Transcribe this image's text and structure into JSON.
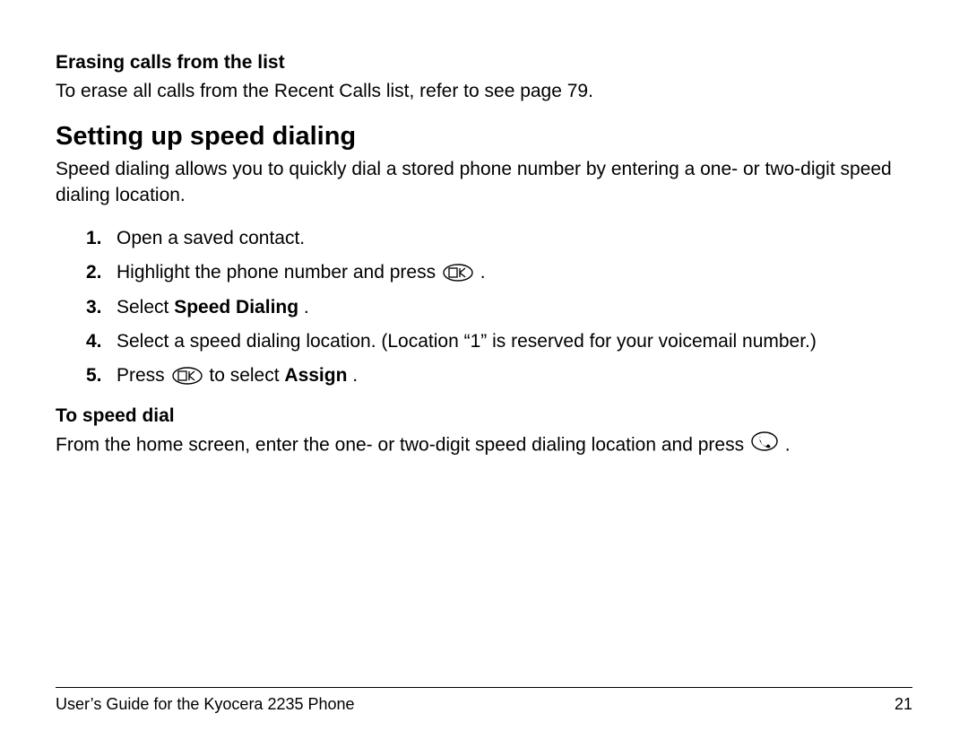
{
  "sections": {
    "erasing": {
      "heading": "Erasing calls from the list",
      "body": "To erase all calls from the Recent Calls list, refer to see page 79."
    },
    "speed_dialing": {
      "heading": "Setting up speed dialing",
      "intro": "Speed dialing allows you to quickly dial a stored phone number by entering a one- or two-digit speed dialing location.",
      "steps": {
        "s1": "Open a saved contact.",
        "s2_pre": "Highlight the phone number and press ",
        "s2_post": " .",
        "s3_pre": "Select ",
        "s3_bold": "Speed Dialing",
        "s3_post": ".",
        "s4": "Select a speed dialing location. (Location “1” is reserved for your voicemail number.)",
        "s5_pre": "Press ",
        "s5_mid": " to select ",
        "s5_bold": "Assign",
        "s5_post": "."
      }
    },
    "to_speed_dial": {
      "heading": "To speed dial",
      "body_pre": "From the home screen, enter the one- or two-digit speed dialing location and press ",
      "body_post": " ."
    }
  },
  "icons": {
    "ok_label": "OK",
    "phone_label": "call"
  },
  "footer": {
    "left": "User’s Guide for the Kyocera 2235 Phone",
    "right": "21"
  },
  "nums": {
    "n1": "1.",
    "n2": "2.",
    "n3": "3.",
    "n4": "4.",
    "n5": "5."
  }
}
